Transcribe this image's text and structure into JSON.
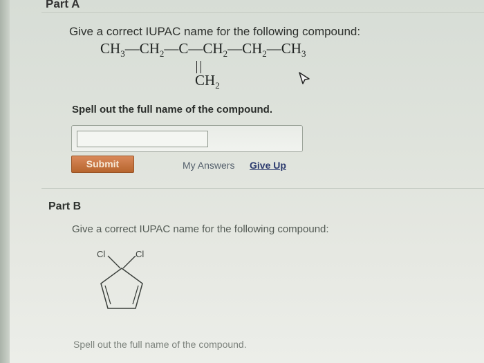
{
  "part_a": {
    "title": "Part A",
    "question": "Give a correct IUPAC name for the following compound:",
    "formula": {
      "ch3_left": "CH",
      "sub3_left": "3",
      "ch2_a": "CH",
      "sub2_a": "2",
      "c_center": "C",
      "ch2_b": "CH",
      "sub2_b": "2",
      "ch2_c": "CH",
      "sub2_c": "2",
      "ch3_right": "CH",
      "sub3_right": "3",
      "bond": "—",
      "substituent": "CH",
      "substituent_sub": "2"
    },
    "instruction": "Spell out the full name of the compound.",
    "answer_value": "",
    "submit_label": "Submit",
    "my_answers_label": "My Answers",
    "give_up_label": "Give Up"
  },
  "part_b": {
    "title": "Part B",
    "question": "Give a correct IUPAC name for the following compound:",
    "molecule_labels": {
      "left": "Cl",
      "right": "Cl"
    },
    "instruction": "Spell out the full name of the compound."
  },
  "colors": {
    "submit": "#c47540",
    "give_up_link": "#2b3a6e",
    "background": "#dfe3dc"
  }
}
